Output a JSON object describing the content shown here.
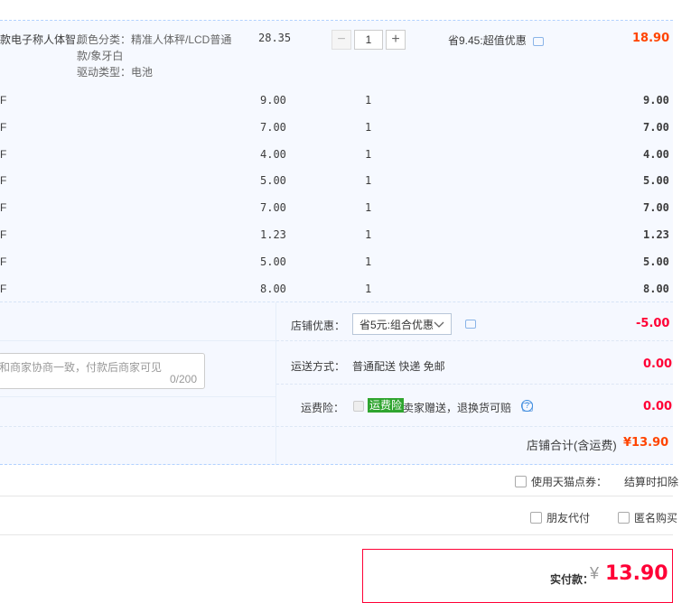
{
  "item": {
    "title_fragment": "款电子称人体智...",
    "sku_color": "颜色分类：精准人体秤/LCD普通",
    "sku_color_cont": "款/象牙白",
    "sku_drive": "驱动类型：电池",
    "unit_price": "28.35",
    "quantity": "1",
    "discount": "省9.45:超值优惠",
    "subtotal": "18.90"
  },
  "bundle_rows": [
    {
      "label": "F",
      "price": "9.00",
      "qty": "1",
      "subtotal": "9.00"
    },
    {
      "label": "F",
      "price": "7.00",
      "qty": "1",
      "subtotal": "7.00"
    },
    {
      "label": "F",
      "price": "4.00",
      "qty": "1",
      "subtotal": "4.00"
    },
    {
      "label": "F",
      "price": "5.00",
      "qty": "1",
      "subtotal": "5.00"
    },
    {
      "label": "F",
      "price": "7.00",
      "qty": "1",
      "subtotal": "7.00"
    },
    {
      "label": "F",
      "price": "1.23",
      "qty": "1",
      "subtotal": "1.23"
    },
    {
      "label": "F",
      "price": "5.00",
      "qty": "1",
      "subtotal": "5.00"
    },
    {
      "label": "F",
      "price": "8.00",
      "qty": "1",
      "subtotal": "8.00"
    }
  ],
  "shop": {
    "coupon_label": "店铺优惠：",
    "coupon_value": "省5元:组合优惠",
    "coupon_amount": "-5.00",
    "shipping_label": "运送方式：",
    "shipping_value": "普通配送 快递 免邮",
    "shipping_amount": "0.00",
    "insurance_label": "运费险：",
    "insurance_badge": "运费险",
    "insurance_text": "卖家赠送，退换货可赔",
    "insurance_amount": "0.00",
    "message_placeholder": "和商家协商一致，付款后商家可见",
    "message_count": "0/200",
    "total_label": "店铺合计(含运费)",
    "total_amount": "¥13.90"
  },
  "options": {
    "tmall_points": "使用天猫点券：",
    "tmall_points_note": "结算时扣除",
    "friend_pay": "朋友代付",
    "anonymous": "匿名购买"
  },
  "payment": {
    "label": "实付款：",
    "currency": "¥",
    "amount": "13.90"
  },
  "colors": {
    "accent_red": "#ff0036",
    "price_orange": "#f40",
    "bg_blue": "#f6f9ff",
    "badge_green": "#2fa52f"
  }
}
